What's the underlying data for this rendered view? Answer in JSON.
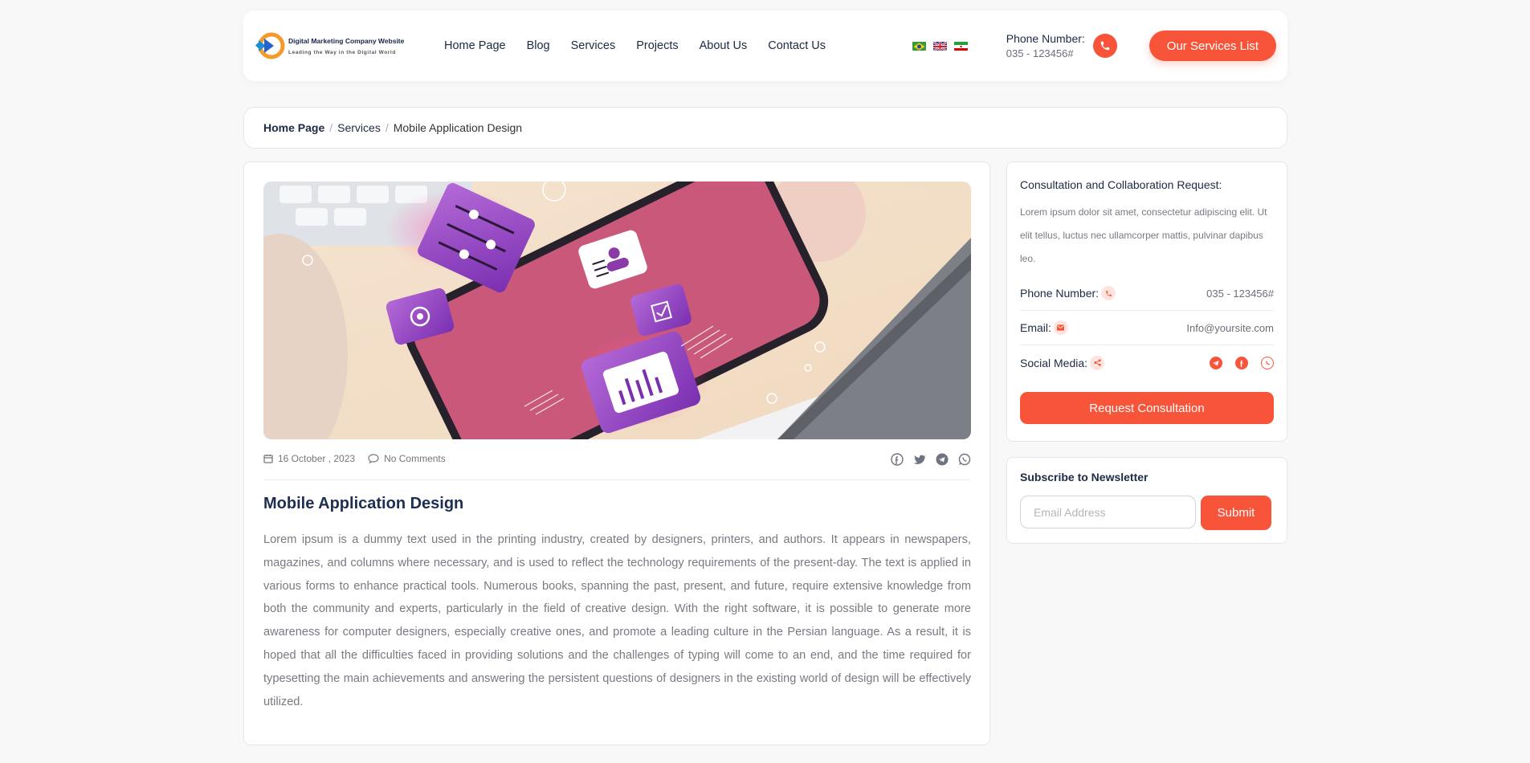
{
  "header": {
    "logo_title": "Digital Marketing Company Website",
    "logo_subtitle": "Leading the Way in the Digital World",
    "nav": [
      "Home Page",
      "Blog",
      "Services",
      "Projects",
      "About Us",
      "Contact Us"
    ],
    "phone_label": "Phone Number:",
    "phone_number": "035 - 123456#",
    "services_button": "Our Services List",
    "flags": [
      "brazil-flag-icon",
      "uk-flag-icon",
      "iran-flag-icon"
    ]
  },
  "breadcrumb": {
    "home": "Home Page",
    "middle": "Services",
    "current": "Mobile Application Design"
  },
  "post": {
    "hero_icon": "mobile-app-illustration",
    "date": "16 October , 2023",
    "comments": "No Comments",
    "share_icons": [
      "facebook-icon",
      "twitter-icon",
      "telegram-icon",
      "whatsapp-icon"
    ],
    "title": "Mobile Application Design",
    "body": "Lorem ipsum is a dummy text used in the printing industry, created by designers, printers, and authors. It appears in newspapers, magazines, and columns where necessary, and is used to reflect the technology requirements of the present-day. The text is applied in various forms to enhance practical tools. Numerous books, spanning the past, present, and future, require extensive knowledge from both the community and experts, particularly in the field of creative design. With the right software, it is possible to generate more awareness for computer designers, especially creative ones, and promote a leading culture in the Persian language. As a result, it is hoped that all the difficulties faced in providing solutions and the challenges of typing will come to an end, and the time required for typesetting the main achievements and answering the persistent questions of designers in the existing world of design will be effectively utilized."
  },
  "sidebar": {
    "consult_title": "Consultation and Collaboration Request:",
    "consult_desc": "Lorem ipsum dolor sit amet, consectetur adipiscing elit. Ut elit tellus, luctus nec ullamcorper mattis, pulvinar dapibus leo.",
    "phone_label": "Phone Number:",
    "phone_value": "035 - 123456#",
    "email_label": "Email:",
    "email_value": "Info@yoursite.com",
    "social_label": "Social Media:",
    "social_icons": [
      "telegram-icon",
      "facebook-icon",
      "whatsapp-icon"
    ],
    "consult_button": "Request Consultation",
    "newsletter_title": "Subscribe to Newsletter",
    "newsletter_placeholder": "Email Address",
    "newsletter_submit": "Submit"
  },
  "colors": {
    "accent": "#f8543a",
    "heading": "#1c2a44",
    "body_text": "#777a82",
    "page_background": "#f8f8f9"
  }
}
